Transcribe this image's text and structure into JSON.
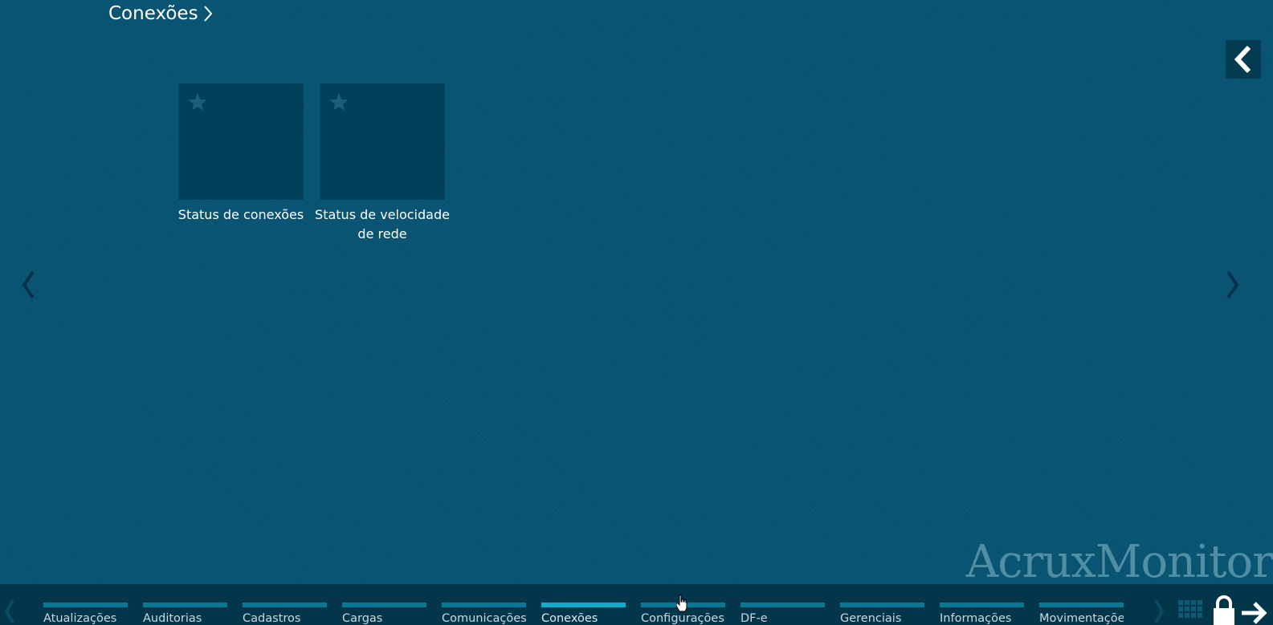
{
  "header": {
    "title": "Conexões"
  },
  "tiles": [
    {
      "label": "Status de conexões"
    },
    {
      "label": "Status de velocidade de rede"
    }
  ],
  "watermark": {
    "text": "AcruxMonitor"
  },
  "bottom_nav": {
    "active_tab": "Conexões",
    "tabs": [
      {
        "label": "Atualizações"
      },
      {
        "label": "Auditorias"
      },
      {
        "label": "Cadastros"
      },
      {
        "label": "Cargas"
      },
      {
        "label": "Comunicações"
      },
      {
        "label": "Conexões"
      },
      {
        "label": "Configurações"
      },
      {
        "label": "DF-e"
      },
      {
        "label": "Gerenciais"
      },
      {
        "label": "Informações"
      },
      {
        "label": "Movimentações"
      }
    ]
  },
  "icons": {
    "title_chevron": "chevron-right-icon",
    "collapse": "chevron-left-icon",
    "tile_star": "star-icon",
    "prev_page": "chevron-left-icon",
    "next_page": "chevron-right-icon",
    "apps": "grid-icon",
    "lock": "lock-icon",
    "exit": "arrow-right-icon"
  },
  "colors": {
    "background": "#085473",
    "tile": "#00405a",
    "bottom_bar": "#04364b",
    "tab_indicator": "#0a7893",
    "tab_indicator_active": "#14aacc"
  }
}
